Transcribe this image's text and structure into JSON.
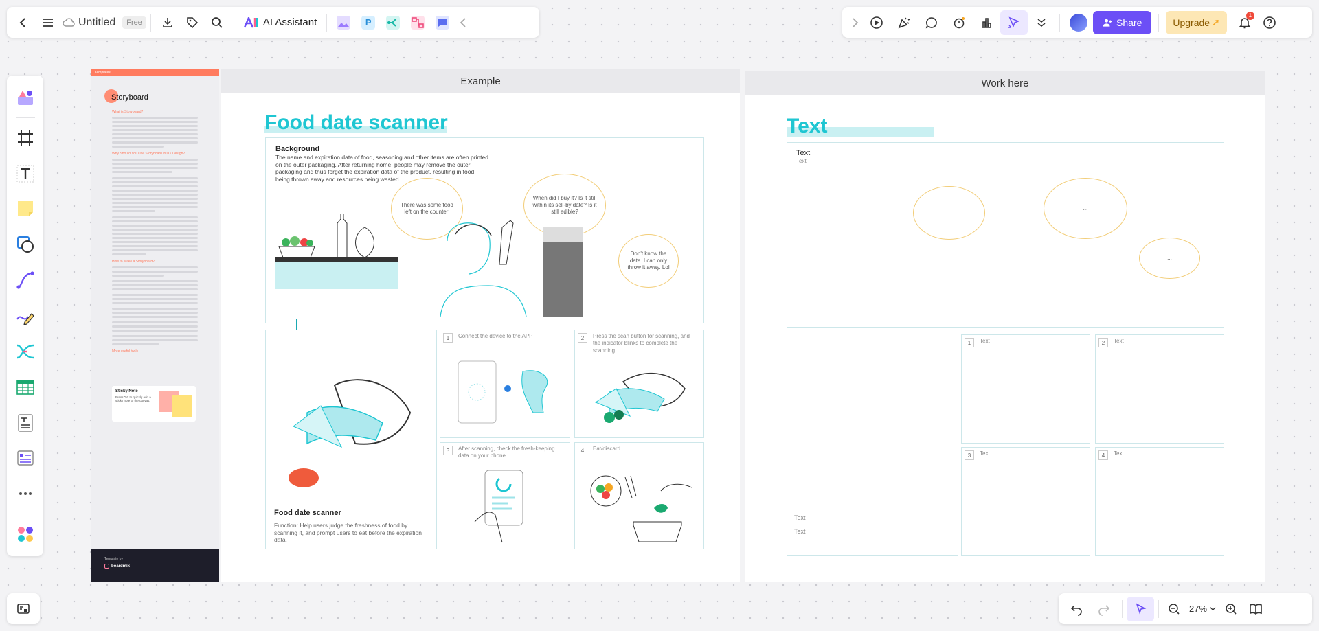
{
  "toolbar_left": {
    "doc_title": "Untitled",
    "plan_badge": "Free",
    "ai_assistant_label": "AI Assistant"
  },
  "toolbar_right": {
    "share_label": "Share",
    "upgrade_label": "Upgrade",
    "notification_count": "1"
  },
  "template_sidebar": {
    "header": "Templates",
    "title": "Storyboard",
    "section_what": "What is Storyboard?",
    "section_why": "Why Should You Use Storyboard in UX Design?",
    "section_how": "How to Make a Storyboard?",
    "section_tools": "More useful tools",
    "sticky_title": "Sticky Note",
    "sticky_desc": "Press \"N\" to quickly add a sticky note to the canvas.",
    "footer_label": "Template by",
    "footer_brand": "boardmix"
  },
  "example_frame": {
    "header": "Example",
    "title": "Food date scanner",
    "background_title": "Background",
    "background_text": "The name and expiration data of food, seasoning and other items are often printed on the outer packaging. After returning home, people may remove the outer packaging and thus forget the expiration data of the product, resulting in food being thrown away and resources being wasted.",
    "bubble1": "There was some food left on the counter!",
    "bubble2": "When did I buy it? Is it still within its sell-by date? Is it still edible?",
    "bubble3": "Don't know the data. I can only throw it away. Lol",
    "product_title": "Food date scanner",
    "product_desc": "Function: Help users judge the freshness of food by scanning it, and prompt users to eat before the expiration data.",
    "steps": [
      {
        "num": "1",
        "text": "Connect the device to the APP"
      },
      {
        "num": "2",
        "text": "Press the scan button for scanning, and the indicator blinks to complete the scanning."
      },
      {
        "num": "3",
        "text": "After scanning, check the fresh-keeping data on your phone."
      },
      {
        "num": "4",
        "text": "Eat/discard"
      }
    ]
  },
  "work_frame": {
    "header": "Work here",
    "title": "Text",
    "box_title": "Text",
    "box_sub": "Text",
    "bubble1": "...",
    "bubble2": "...",
    "bubble3": "...",
    "left_text1": "Text",
    "left_text2": "Text",
    "steps": [
      {
        "num": "1",
        "text": "Text"
      },
      {
        "num": "2",
        "text": "Text"
      },
      {
        "num": "3",
        "text": "Text"
      },
      {
        "num": "4",
        "text": "Text"
      }
    ]
  },
  "zoom": {
    "level": "27%"
  },
  "colors": {
    "accent_teal": "#1fc6d2",
    "share_purple": "#6c4ff6",
    "upgrade_yellow": "#fde7b5",
    "template_orange": "#ff7b5f",
    "bubble_yellow": "#f2cd78"
  }
}
